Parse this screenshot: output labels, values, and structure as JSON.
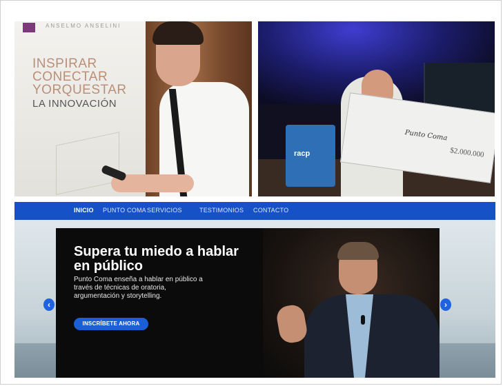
{
  "photo_left": {
    "brand": "ANSELMO ANSELINI",
    "words": [
      "INSPIRAR",
      "CONECTAR",
      "YORQUESTAR",
      "LA INNOVACIÓN"
    ]
  },
  "photo_right": {
    "bag_text": "racp",
    "check_name": "Punto Coma",
    "check_amount": "$2.000.000"
  },
  "site": {
    "nav": [
      "INICIO",
      "PUNTO COMA",
      "SERVICIOS",
      "TESTIMONIOS",
      "CONTACTO"
    ],
    "hero": {
      "title": "Supera tu miedo a hablar en público",
      "text": "Punto Coma enseña a hablar en público a través de técnicas de oratoria, argumentación y storytelling.",
      "button": "INSCRÍBETE AHORA"
    },
    "arrows": {
      "prev": "‹",
      "next": "›"
    }
  },
  "colors": {
    "nav": "#1751c7",
    "button": "#1b5fd8",
    "accent": "#1f63e0"
  }
}
